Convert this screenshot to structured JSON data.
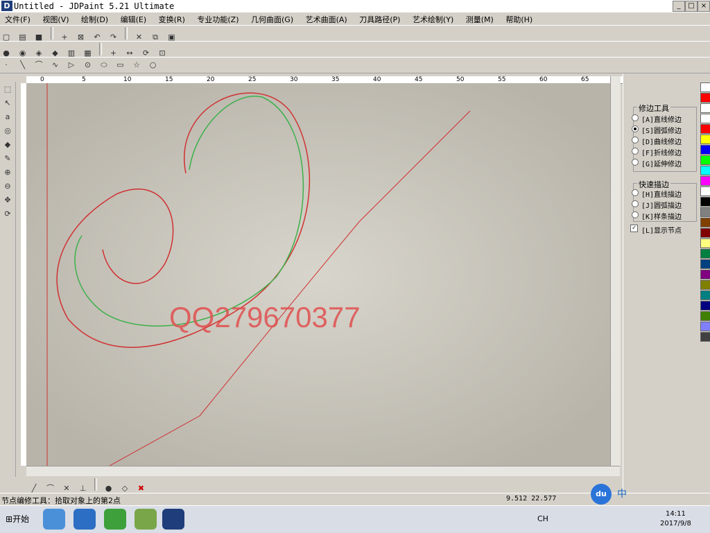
{
  "window": {
    "title": "Untitled - JDPaint 5.21 Ultimate",
    "logo": "D",
    "min": "_",
    "max": "□",
    "close": "×"
  },
  "menu": [
    "文件(F)",
    "视图(V)",
    "绘制(D)",
    "编辑(E)",
    "变换(R)",
    "专业功能(Z)",
    "几何曲面(G)",
    "艺术曲面(A)",
    "刀具路径(P)",
    "艺术绘制(Y)",
    "测量(M)",
    "帮助(H)"
  ],
  "toolbar_icons": {
    "row1": [
      "new-icon",
      "open-icon",
      "save-icon",
      "cross-icon",
      "box-icon",
      "undo-icon",
      "redo-icon",
      "cut-icon",
      "copy-icon",
      "paste-icon"
    ],
    "row2": [
      "pin-icon",
      "bulb-icon",
      "layer-icon",
      "fill-icon",
      "erase-icon",
      "cube-icon",
      "grid-icon",
      "plus-icon",
      "measure-icon",
      "rotate-icon",
      "node-icon",
      "circle-icon"
    ],
    "row3": [
      "line-icon",
      "arc-icon",
      "wave-icon",
      "triangle-icon",
      "circle-icon",
      "ellipse-icon",
      "rect-icon",
      "star-icon",
      "ring-icon"
    ]
  },
  "panel": {
    "group1_title": "修边工具",
    "group1_options": [
      "[A]直线修边",
      "[S]圆弧修边",
      "[D]曲线修边",
      "[F]折线修边",
      "[G]延伸修边"
    ],
    "group1_selected": 1,
    "group2_title": "快速描边",
    "group2_options": [
      "[H]直线描边",
      "[J]圆弧描边",
      "[K]样条描边"
    ],
    "show_nodes_label": "[L]显示节点",
    "show_nodes_checked": true
  },
  "palette": [
    "#ffffff",
    "#ff0000",
    "#ffffff",
    "#ffffff",
    "#ff0000",
    "#ffff00",
    "#0000ff",
    "#00ff00",
    "#00ffff",
    "#ff00ff",
    "#ffffff",
    "#000000",
    "#808080",
    "#804000",
    "#800000",
    "#ffff80",
    "#008040",
    "#004080",
    "#800080",
    "#808000",
    "#008080",
    "#000080",
    "#408000",
    "#8080ff",
    "#404040"
  ],
  "canvas": {
    "watermark": "QQ279670377"
  },
  "ruler_labels": [
    "0",
    "5",
    "10",
    "15",
    "20",
    "25",
    "30",
    "35",
    "40",
    "45",
    "50",
    "55",
    "60",
    "65"
  ],
  "status": {
    "text": "节点编修工具：拾取对象上的第2点",
    "coords": "9.512  22.577"
  },
  "taskbar": {
    "start": "开始",
    "lang": "CH",
    "time": "14:11",
    "date": "2017/9/8",
    "ime": "中",
    "ime_extra": "du"
  }
}
